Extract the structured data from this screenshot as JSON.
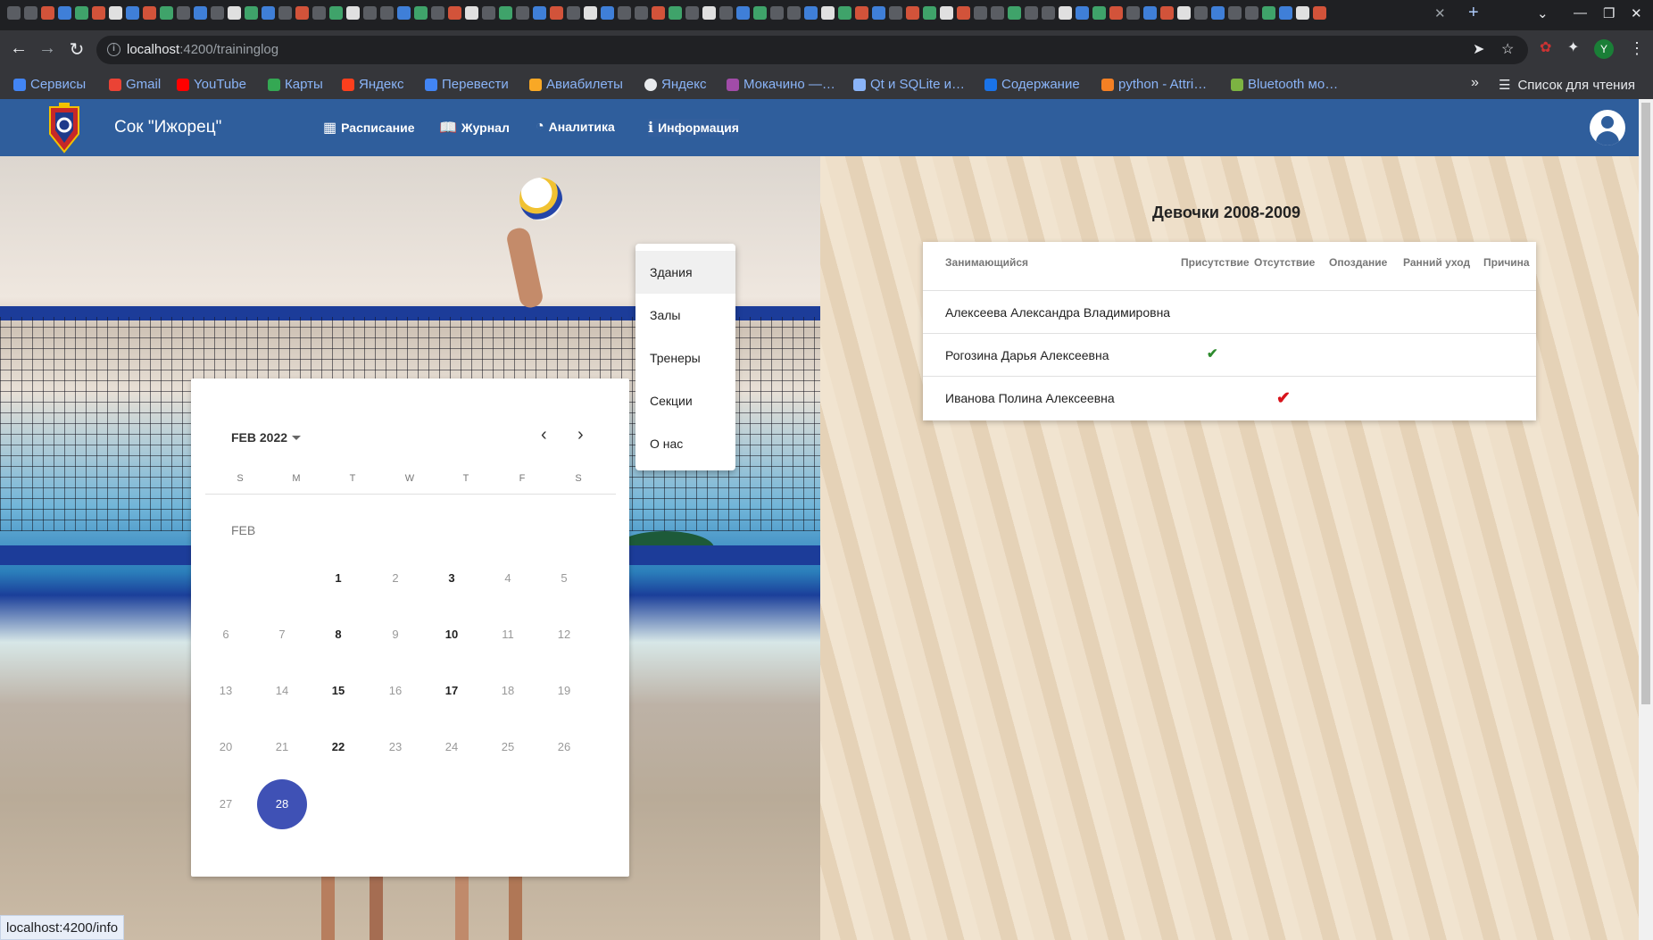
{
  "browser": {
    "url_host": "localhost",
    "url_path": ":4200/traininglog",
    "profile_initial": "Y",
    "bookmarks": [
      "Сервисы",
      "Gmail",
      "YouTube",
      "Карты",
      "Яндекс",
      "Перевести",
      "Авиабилеты",
      "Яндекс",
      "Мокачино —…",
      "Qt и SQLite и…",
      "Содержание",
      "python - Attri…",
      "Bluetooth мо…"
    ],
    "reading_list": "Список для чтения",
    "status_url": "localhost:4200/info"
  },
  "app": {
    "brand": "Сок \"Ижорец\"",
    "nav": {
      "schedule": "Расписание",
      "journal": "Журнал",
      "analytics": "Аналитика",
      "info": "Информация"
    },
    "info_menu": [
      "Здания",
      "Залы",
      "Тренеры",
      "Секции",
      "О нас"
    ]
  },
  "calendar": {
    "period": "FEB 2022",
    "month_label": "FEB",
    "weekdays": [
      "S",
      "M",
      "T",
      "W",
      "T",
      "F",
      "S"
    ],
    "days": [
      "1",
      "2",
      "3",
      "4",
      "5",
      "6",
      "7",
      "8",
      "9",
      "10",
      "11",
      "12",
      "13",
      "14",
      "15",
      "16",
      "17",
      "18",
      "19",
      "20",
      "21",
      "22",
      "23",
      "24",
      "25",
      "26",
      "27",
      "28"
    ],
    "highlighted_days": [
      "1",
      "3",
      "8",
      "10",
      "15",
      "17",
      "22"
    ],
    "selected_day": "28",
    "first_weekday_index": 2
  },
  "journal": {
    "title": "Девочки 2008-2009",
    "columns": [
      "Занимающийся",
      "Присутствие",
      "Отсутствие",
      "Опоздание",
      "Ранний уход",
      "Причина"
    ],
    "rows": [
      {
        "name": "Алексеева Александра Владимировна",
        "mark": ""
      },
      {
        "name": "Рогозина Дарья Алексеевна",
        "mark": "present"
      },
      {
        "name": "Иванова Полина Алексеевна",
        "mark": "absent"
      }
    ],
    "colors": {
      "present": "#2e8b2e",
      "absent": "#d8141c"
    }
  },
  "colors": {
    "header": "#2f5e9c",
    "selected_day": "#3f51b5"
  }
}
